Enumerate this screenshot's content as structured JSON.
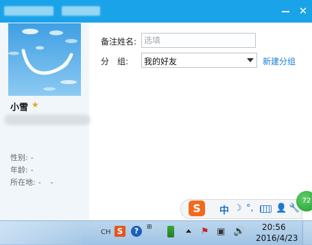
{
  "window": {
    "minimize_icon": "minimize-icon",
    "close_icon": "close-icon",
    "close_glyph": "✕",
    "accent": "#1aa3e8"
  },
  "profile": {
    "nickname": "小雪",
    "star_glyph": "★",
    "fields": [
      {
        "label": "性别:",
        "value": "-"
      },
      {
        "label": "年龄:",
        "value": "-"
      },
      {
        "label": "所在地:",
        "value": "-    -"
      }
    ]
  },
  "form": {
    "remark_label": "备注姓名:",
    "remark_placeholder": "选填",
    "remark_value": "",
    "group_label": "分　组:",
    "group_value": "我的好友",
    "new_group_link": "新建分组"
  },
  "ime": {
    "logo": "S",
    "lang": "中",
    "moon": "☽",
    "punct": "°,",
    "user_glyph": "👤",
    "tool_glyph": "🔧",
    "badge": "72"
  },
  "taskbar": {
    "lang": "CH",
    "sogou": "S",
    "help": "?",
    "control_glyph": "⊞",
    "flag_glyph": "⚑",
    "net_glyph": "▣",
    "vol_glyph": "🔊",
    "time": "20:56",
    "date": "2016/4/23"
  }
}
